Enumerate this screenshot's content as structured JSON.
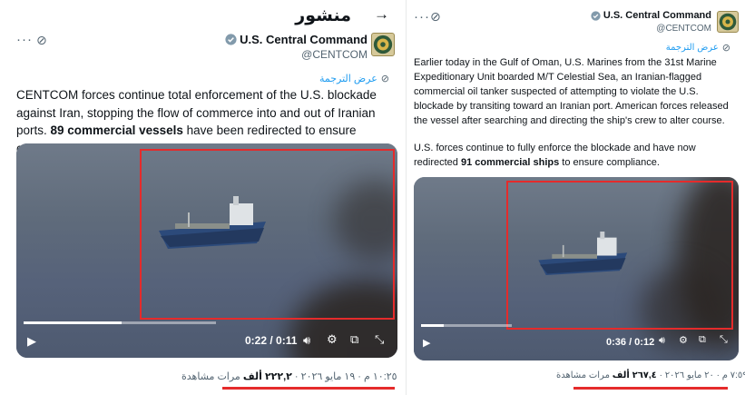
{
  "left": {
    "page_title": "منشور",
    "account_name": "U.S. Central Command",
    "handle": "@CENTCOM",
    "translate_label": "عرض الترجمة",
    "text_pre": "CENTCOM forces continue total enforcement of the U.S. blockade against Iran, stopping the flow of commerce into and out of Iranian ports. ",
    "text_bold": "89 commercial vessels",
    "text_post": " have been redirected to ensure compliance.",
    "video_time": "0:22 / 0:11",
    "progress_fraction": 0.51,
    "meta_time": "١٠:٢٥ م",
    "meta_date": "١٩ مايو ٢٠٢٦",
    "meta_views_number": "٢٢٢,٢ ألف",
    "meta_views_label": "مرات مشاهدة"
  },
  "right": {
    "account_name": "U.S. Central Command",
    "handle": "@CENTCOM",
    "translate_label": "عرض الترجمة",
    "para1": "Earlier today in the Gulf of Oman, U.S. Marines from the 31st Marine Expeditionary Unit boarded M/T Celestial Sea, an Iranian-flagged commercial oil tanker suspected of attempting to violate the U.S. blockade by transiting toward an Iranian port. American forces released the vessel after searching and directing the ship's crew to alter course.",
    "para2_pre": "U.S. forces continue to fully enforce the blockade and have now redirected ",
    "para2_bold": "91 commercial ships",
    "para2_post": " to ensure compliance.",
    "video_time": "0:36 / 0:12",
    "progress_fraction": 0.25,
    "meta_time": "٧:٥٩ م",
    "meta_date": "٢٠ مايو ٢٠٢٦",
    "meta_views_number": "٢٦٧,٤ ألف",
    "meta_views_label": "مرات مشاهدة"
  },
  "colors": {
    "accent": "#1d9bf0",
    "highlight": "#e52b2b",
    "muted": "#536471"
  },
  "icons": [
    "back-arrow-icon",
    "more-icon",
    "grok-icon",
    "verified-icon",
    "globe-icon",
    "play-icon",
    "volume-icon",
    "settings-icon",
    "pip-icon",
    "fullscreen-icon"
  ]
}
